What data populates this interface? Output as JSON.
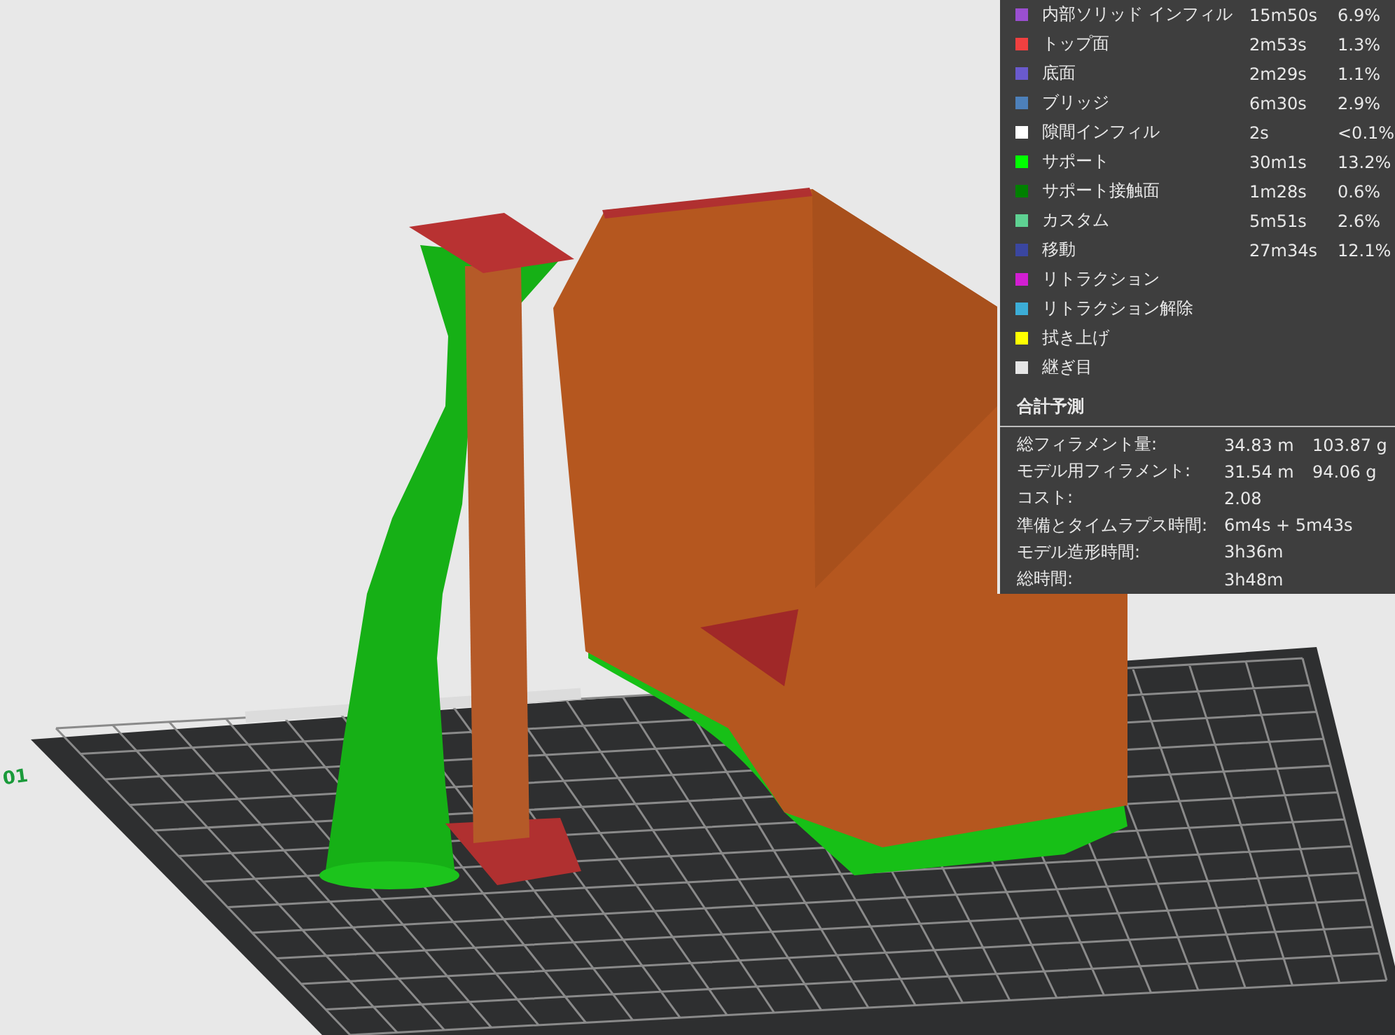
{
  "viewport": {
    "plate_label": "01"
  },
  "legend": {
    "items": [
      {
        "label": "内部ソリッド インフィル",
        "time": "15m50s",
        "percent": "6.9%",
        "color": "#9a4fd0"
      },
      {
        "label": "トップ面",
        "time": "2m53s",
        "percent": "1.3%",
        "color": "#f04040"
      },
      {
        "label": "底面",
        "time": "2m29s",
        "percent": "1.1%",
        "color": "#6a5acd"
      },
      {
        "label": "ブリッジ",
        "time": "6m30s",
        "percent": "2.9%",
        "color": "#4d80ba"
      },
      {
        "label": "隙間インフィル",
        "time": "2s",
        "percent": "<0.1%",
        "color": "#ffffff"
      },
      {
        "label": "サポート",
        "time": "30m1s",
        "percent": "13.2%",
        "color": "#00ff00"
      },
      {
        "label": "サポート接触面",
        "time": "1m28s",
        "percent": "0.6%",
        "color": "#008000"
      },
      {
        "label": "カスタム",
        "time": "5m51s",
        "percent": "2.6%",
        "color": "#5ed192"
      },
      {
        "label": "移動",
        "time": "27m34s",
        "percent": "12.1%",
        "color": "#3a46a0"
      },
      {
        "label": "リトラクション",
        "color": "#d21ed2"
      },
      {
        "label": "リトラクション解除",
        "color": "#3cadd7"
      },
      {
        "label": "拭き上げ",
        "color": "#ffff00"
      },
      {
        "label": "継ぎ目",
        "color": "#e6e6e6"
      }
    ]
  },
  "totals": {
    "title": "合計予測",
    "rows": [
      {
        "label": "総フィラメント量:",
        "values": [
          "34.83 m",
          "103.87 g"
        ]
      },
      {
        "label": "モデル用フィラメント:",
        "values": [
          "31.54 m",
          "94.06 g"
        ]
      },
      {
        "label": "コスト:",
        "values": [
          "2.08"
        ]
      },
      {
        "label": "準備とタイムラプス時間:",
        "values": [
          "6m4s + 5m43s"
        ]
      },
      {
        "label": "モデル造形時間:",
        "values": [
          "3h36m"
        ]
      },
      {
        "label": "総時間:",
        "values": [
          "3h48m"
        ]
      }
    ]
  }
}
